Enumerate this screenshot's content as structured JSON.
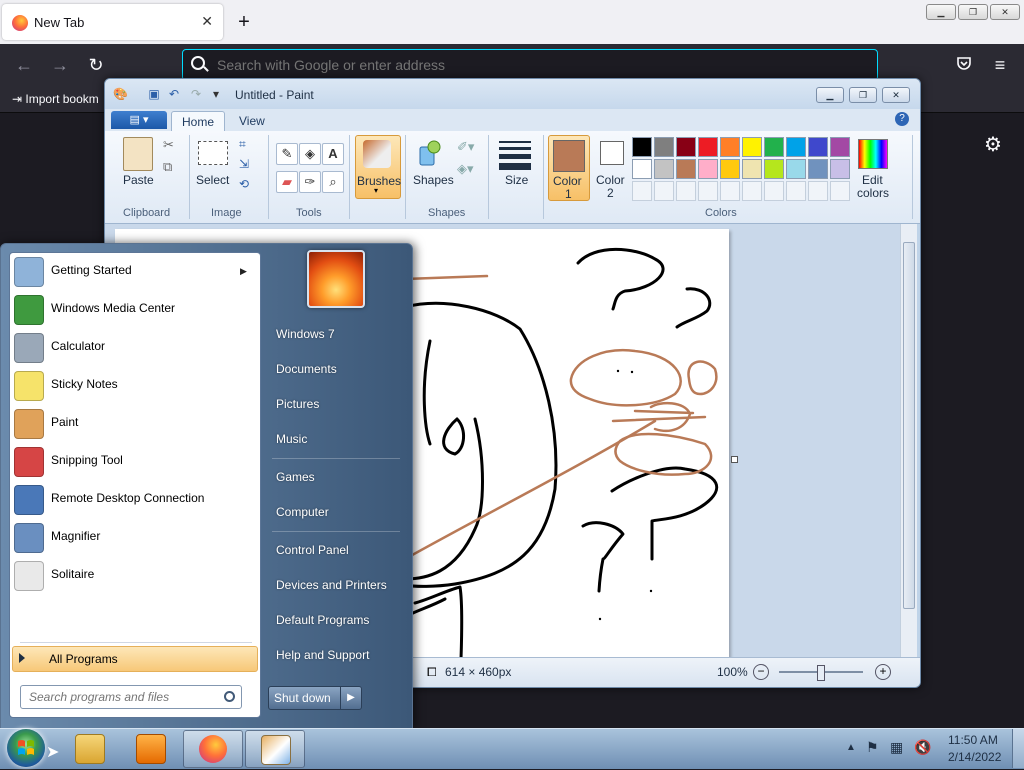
{
  "firefox": {
    "tab_title": "New Tab",
    "tab_close": "✕",
    "new_tab": "+",
    "url_placeholder": "Search with Google or enter address",
    "bookmark_import": "Import bookm",
    "window_controls": [
      "▁",
      "❐",
      "✕"
    ]
  },
  "paint": {
    "title": "Untitled - Paint",
    "tabs": [
      "Home",
      "View"
    ],
    "groups": [
      "Clipboard",
      "Image",
      "Tools",
      "Shapes",
      "Colors"
    ],
    "buttons": {
      "paste": "Paste",
      "select": "Select",
      "brushes": "Brushes",
      "shapes": "Shapes",
      "size": "Size",
      "color1": "Color",
      "color1_num": "1",
      "color2": "Color",
      "color2_num": "2",
      "edit_colors_1": "Edit",
      "edit_colors_2": "colors"
    },
    "palette_row1": [
      "#000000",
      "#7f7f7f",
      "#880015",
      "#ed1c24",
      "#ff7f27",
      "#fff200",
      "#22b14c",
      "#00a2e8",
      "#3f48cc",
      "#a349a4"
    ],
    "palette_row2": [
      "#ffffff",
      "#c3c3c3",
      "#b97a57",
      "#ffaec9",
      "#ffc90e",
      "#efe4b0",
      "#b5e61d",
      "#99d9ea",
      "#7092be",
      "#c8bfe7"
    ],
    "color1_value": "#b97a57",
    "color2_value": "#ffffff",
    "status_dimensions": "614 × 460px",
    "zoom": "100%",
    "zoom_fraction": 0.5
  },
  "start_menu": {
    "programs": [
      {
        "label": "Getting Started",
        "icon": "getting-started-icon",
        "color": "#8fb3d9"
      },
      {
        "label": "Windows Media Center",
        "icon": "media-center-icon",
        "color": "#3f9a3f"
      },
      {
        "label": "Calculator",
        "icon": "calculator-icon",
        "color": "#9aa8b8"
      },
      {
        "label": "Sticky Notes",
        "icon": "sticky-notes-icon",
        "color": "#f6e36a"
      },
      {
        "label": "Paint",
        "icon": "paint-icon",
        "color": "#e0a25a"
      },
      {
        "label": "Snipping Tool",
        "icon": "snipping-tool-icon",
        "color": "#d64545"
      },
      {
        "label": "Remote Desktop Connection",
        "icon": "remote-desktop-icon",
        "color": "#4a78b8"
      },
      {
        "label": "Magnifier",
        "icon": "magnifier-icon",
        "color": "#6a8fc0"
      },
      {
        "label": "Solitaire",
        "icon": "solitaire-icon",
        "color": "#e9e9e9"
      }
    ],
    "all_programs": "All Programs",
    "search_placeholder": "Search programs and files",
    "right_items": [
      "Windows 7",
      "Documents",
      "Pictures",
      "Music",
      "Games",
      "Computer",
      "Control Panel",
      "Devices and Printers",
      "Default Programs",
      "Help and Support"
    ],
    "shutdown": "Shut down",
    "shutdown_arrow": "▶"
  },
  "taskbar": {
    "time": "11:50 AM",
    "date": "2/14/2022"
  }
}
